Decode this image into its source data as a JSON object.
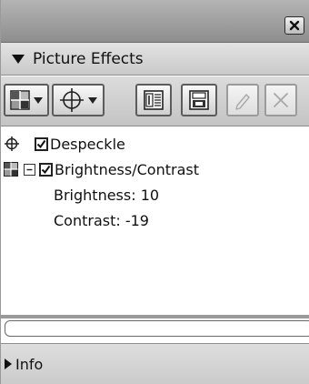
{
  "title_bar": {
    "close_icon": "close-x-icon"
  },
  "panel": {
    "title": "Picture Effects",
    "expand_icon": "triangle-down-icon"
  },
  "toolbar": {
    "buttons": [
      {
        "name": "grid-effect-dropdown",
        "icon": "grid-icon",
        "dropdown": true,
        "enabled": true
      },
      {
        "name": "crosshair-effect-dropdown",
        "icon": "crosshair-icon",
        "dropdown": true,
        "enabled": true
      },
      {
        "name": "properties-button",
        "icon": "properties-icon",
        "dropdown": false,
        "enabled": true
      },
      {
        "name": "save-effect-button",
        "icon": "save-icon",
        "dropdown": false,
        "enabled": true
      },
      {
        "name": "edit-button",
        "icon": "pencil-icon",
        "dropdown": false,
        "enabled": false
      },
      {
        "name": "delete-button",
        "icon": "x-icon",
        "dropdown": false,
        "enabled": false
      }
    ]
  },
  "effects": [
    {
      "label": "Despeckle",
      "checked": true,
      "icon": "crosshair-icon",
      "expanded": null
    },
    {
      "label": "Brightness/Contrast",
      "checked": true,
      "icon": "grid-icon",
      "expanded": true,
      "params": [
        {
          "text": "Brightness: 10"
        },
        {
          "text": "Contrast: -19"
        }
      ]
    }
  ],
  "info": {
    "label": "Info",
    "expand_icon": "triangle-right-icon"
  }
}
